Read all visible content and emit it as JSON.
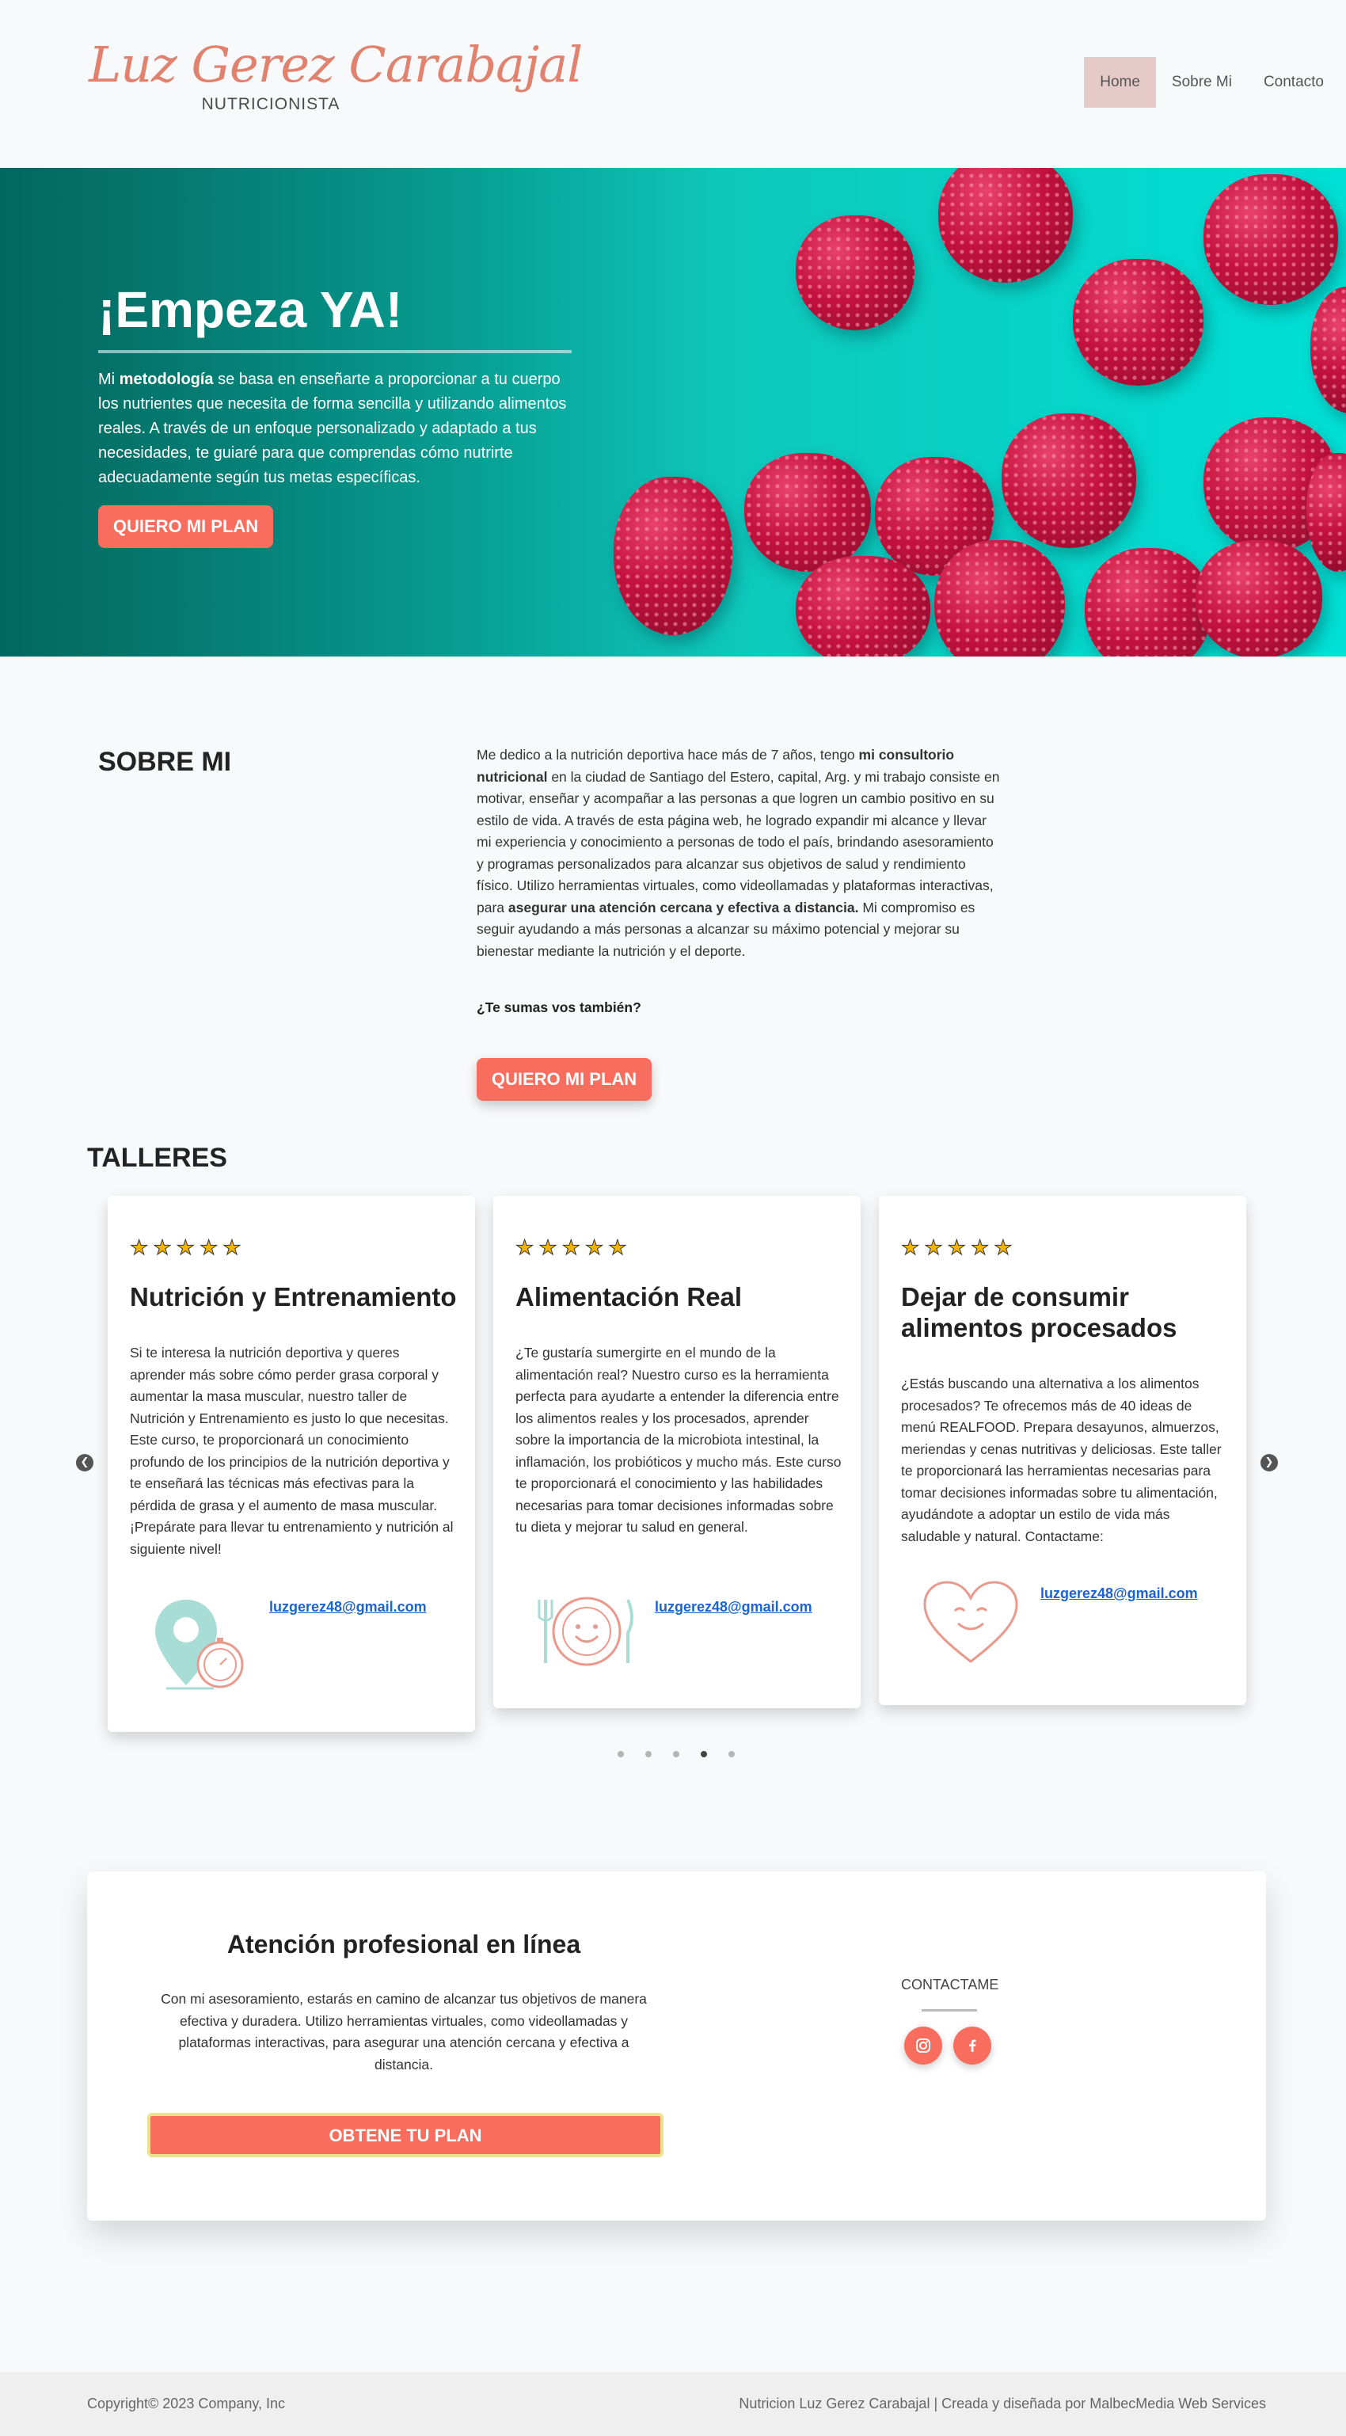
{
  "header": {
    "logo_name": "Luz Gerez Carabajal",
    "logo_sub": "NUTRICIONISTA",
    "nav": [
      "Home",
      "Sobre Mi",
      "Contacto"
    ]
  },
  "hero": {
    "title": "¡Empeza YA!",
    "text_pre": "Mi ",
    "text_bold": "metodología",
    "text_post": " se basa en enseñarte a proporcionar a tu cuerpo los nutrientes que necesita de forma sencilla y utilizando alimentos reales. A través de un enfoque personalizado y adaptado a tus necesidades, te guiaré para que comprendas cómo nutrirte adecuadamente según tus metas específicas.",
    "button": "QUIERO MI PLAN"
  },
  "about": {
    "title": "SOBRE MI",
    "p1": "Me dedico a la nutrición deportiva hace más de 7 años, tengo ",
    "b1": "mi consultorio nutricional",
    "p2": " en la ciudad de Santiago del Estero, capital, Arg. y mi trabajo consiste en motivar, enseñar y acompañar a las personas a que logren un cambio positivo en su estilo de vida. A través de esta página web, he logrado expandir mi alcance y llevar mi experiencia y conocimiento a personas de todo el país, brindando asesoramiento y programas personalizados para alcanzar sus objetivos de salud y rendimiento físico. Utilizo herramientas virtuales, como videollamadas y plataformas interactivas, para ",
    "b2": "asegurar una atención cercana y efectiva a distancia.",
    "p3": " Mi compromiso es seguir ayudando a más personas a alcanzar su máximo potencial y mejorar su bienestar mediante la nutrición y el deporte.",
    "question": "¿Te sumas vos también?",
    "button": "QUIERO MI PLAN"
  },
  "talleres": {
    "title": "TALLERES",
    "rating": 5,
    "cards": [
      {
        "title": "Nutrición y Entrenamiento",
        "text": "Si te interesa la nutrición deportiva y queres aprender más sobre cómo perder grasa corporal y aumentar la masa muscular, nuestro taller de Nutrición y Entrenamiento es justo lo que necesitas. Este curso, te proporcionará un conocimiento profundo de los principios de la nutrición deportiva y te enseñará las técnicas más efectivas para la pérdida de grasa y el aumento de masa muscular. ¡Prepárate para llevar tu entrenamiento y nutrición al siguiente nivel!",
        "email": "luzgerez48@gmail.com",
        "icon": "location-timer-icon"
      },
      {
        "title": "Alimentación Real",
        "text": "¿Te gustaría sumergirte en el mundo de la alimentación real? Nuestro curso es la herramienta perfecta para ayudarte a entender la diferencia entre los alimentos reales y los procesados, aprender sobre la importancia de la microbiota intestinal, la inflamación, los probióticos y mucho más. Este curso te proporcionará el conocimiento y las habilidades necesarias para tomar decisiones informadas sobre tu dieta y mejorar tu salud en general.",
        "email": "luzgerez48@gmail.com",
        "icon": "smiling-plate-icon"
      },
      {
        "title": "Dejar de consumir alimentos procesados",
        "text": "¿Estás buscando una alternativa a los alimentos procesados? Te ofrecemos más de 40 ideas de menú REALFOOD. Prepara desayunos, almuerzos, meriendas y cenas nutritivas y deliciosas. Este taller te proporcionará las herramientas necesarias para tomar decisiones informadas sobre tu alimentación, ayudándote a adoptar un estilo de vida más saludable y natural. Contactame:",
        "email": "luzgerez48@gmail.com",
        "icon": "smiling-heart-icon"
      }
    ],
    "pagination": {
      "count": 5,
      "active": 4
    }
  },
  "contact": {
    "title": "Atención profesional en línea",
    "text": "Con mi asesoramiento, estarás en camino de alcanzar tus objetivos de manera efectiva y duradera. Utilizo herramientas virtuales, como videollamadas y plataformas interactivas, para asegurar una atención cercana y efectiva a distancia.",
    "button": "OBTENE TU PLAN",
    "label": "CONTACTAME",
    "social": [
      "instagram-icon",
      "facebook-icon"
    ]
  },
  "footer": {
    "left": "Copyright© 2023 Company, Inc",
    "right": "Nutricion Luz Gerez Carabajal | Creada y diseñada por MalbecMedia Web Services"
  },
  "colors": {
    "accent": "#f86d5e",
    "logo": "#e1826f",
    "hero_bg": "#0ec8bc",
    "nav_active": "#e6c9c9"
  }
}
